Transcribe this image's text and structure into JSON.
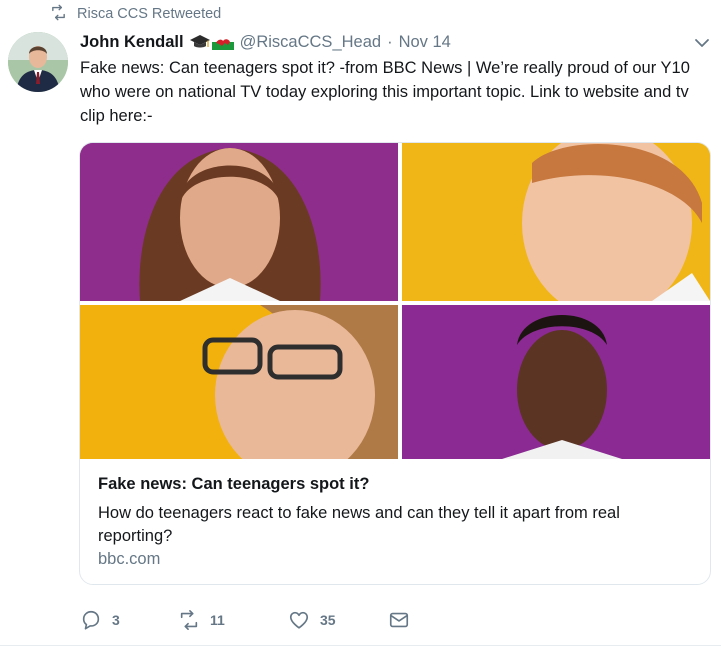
{
  "retweet": {
    "label": "Risca CCS Retweeted"
  },
  "tweet": {
    "author_name": "John Kendall",
    "emoji": [
      "graduation-cap",
      "wales-flag"
    ],
    "handle": "@RiscaCCS_Head",
    "separator": "·",
    "timestamp": "Nov 14",
    "text": "Fake news: Can teenagers spot it? -from BBC News | We’re really proud of our Y10 who were on national TV today exploring this important topic. Link to website and tv clip here:-"
  },
  "card": {
    "title": "Fake news: Can teenagers spot it?",
    "description": "How do teenagers react to fake news and can they tell it apart from real reporting?",
    "domain": "bbc.com",
    "backgrounds": [
      "#8e2d8c",
      "#f0b617",
      "#f2b10c",
      "#8a2a92"
    ]
  },
  "actions": {
    "reply_count": "3",
    "retweet_count": "11",
    "like_count": "35"
  },
  "icons": [
    "retweet-icon",
    "avatar",
    "caret-down-icon",
    "reply-icon",
    "like-icon",
    "message-icon"
  ],
  "colors": {
    "secondary_text": "#657786",
    "primary_text": "#14171a",
    "border": "#e1e8ed"
  }
}
